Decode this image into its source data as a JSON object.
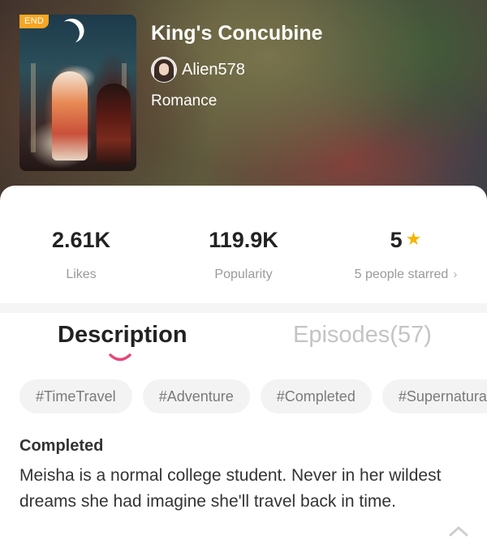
{
  "book": {
    "badge": "END",
    "title": "King's Concubine",
    "author": "Alien578",
    "genre": "Romance"
  },
  "stats": {
    "likes_value": "2.61K",
    "likes_label": "Likes",
    "popularity_value": "119.9K",
    "popularity_label": "Popularity",
    "rating_value": "5",
    "rating_label": "5 people starred"
  },
  "tabs": {
    "description": "Description",
    "episodes": "Episodes(57)"
  },
  "tags": [
    "#TimeTravel",
    "#Adventure",
    "#Completed",
    "#Supernatural"
  ],
  "status": "Completed",
  "description": "Meisha is a normal college student. Never in her wildest dreams she had imagine she'll travel back in time.",
  "colors": {
    "accent": "#e8457a",
    "badge": "#f5a623",
    "star": "#f5b400"
  },
  "icons": {
    "rating": "star-icon",
    "more": "chevron-right-icon",
    "scroll": "chevron-up-icon"
  }
}
